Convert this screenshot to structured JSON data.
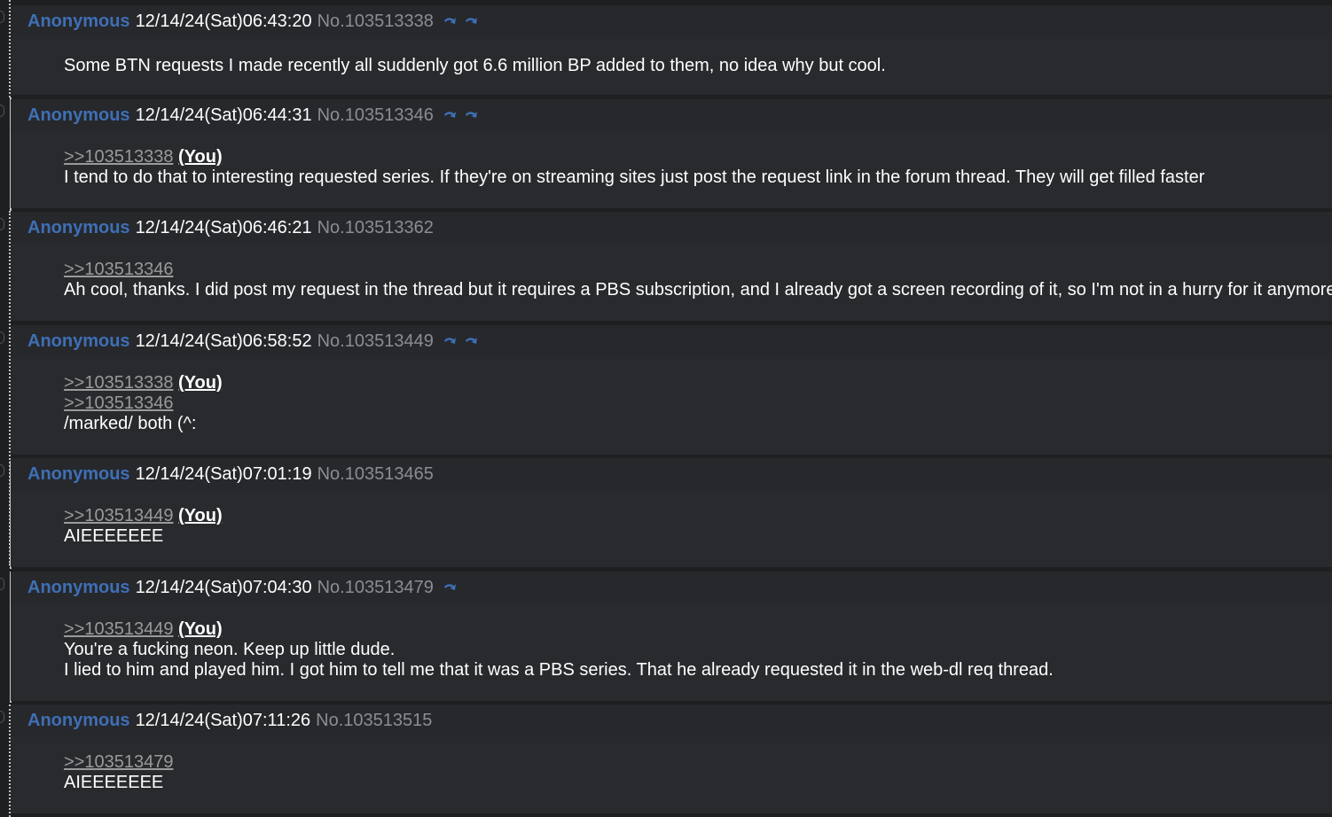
{
  "posts": [
    {
      "name": "Anonymous",
      "date": "12/14/24(Sat)06:43:20",
      "no": "No.103513338",
      "lines": [
        {
          "text": "Some BTN requests I made recently all suddenly got 6.6 million BP added to them, no idea why but cool."
        }
      ]
    },
    {
      "name": "Anonymous",
      "date": "12/14/24(Sat)06:44:31",
      "no": "No.103513346",
      "lines": [
        {
          "quote": ">>103513338",
          "you": "(You)"
        },
        {
          "text": "I tend to do that to interesting requested series. If they're on streaming sites just post the request link in the forum thread. They will get filled faster"
        }
      ]
    },
    {
      "name": "Anonymous",
      "date": "12/14/24(Sat)06:46:21",
      "no": "No.103513362",
      "lines": [
        {
          "quote": ">>103513346"
        },
        {
          "text": "Ah cool, thanks. I did post my request in the thread but it requires a PBS subscription, and I already got a screen recording of it, so I'm not in a hurry for it anymore."
        }
      ]
    },
    {
      "name": "Anonymous",
      "date": "12/14/24(Sat)06:58:52",
      "no": "No.103513449",
      "lines": [
        {
          "quote": ">>103513338",
          "you": "(You)"
        },
        {
          "quote": ">>103513346"
        },
        {
          "text": "/marked/ both (^:"
        }
      ]
    },
    {
      "name": "Anonymous",
      "date": "12/14/24(Sat)07:01:19",
      "no": "No.103513465",
      "lines": [
        {
          "quote": ">>103513449",
          "you": "(You)"
        },
        {
          "text": "AIEEEEEEE"
        }
      ]
    },
    {
      "name": "Anonymous",
      "date": "12/14/24(Sat)07:04:30",
      "no": "No.103513479",
      "lines": [
        {
          "quote": ">>103513449",
          "you": "(You)"
        },
        {
          "text": "You're a fucking neon. Keep up little dude."
        },
        {
          "text": "I lied to him and played him. I got him to tell me that it was a PBS series. That he already requested it in the web-dl req thread."
        }
      ]
    },
    {
      "name": "Anonymous",
      "date": "12/14/24(Sat)07:11:26",
      "no": "No.103513515",
      "lines": [
        {
          "quote": ">>103513479"
        },
        {
          "text": "AIEEEEEEE"
        }
      ]
    }
  ],
  "icons": {
    "backlink": "reply-arrow-icon"
  },
  "colors": {
    "name": "#3f6fb5",
    "postno": "#8a8d91",
    "quotelink": "#9a9a9a",
    "post_bg": "#282a2e",
    "page_bg": "#1d1f21"
  }
}
